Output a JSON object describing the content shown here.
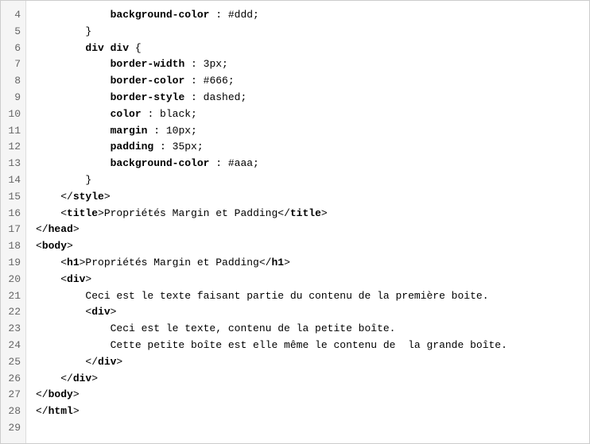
{
  "lines": [
    {
      "num": "4",
      "content": [
        {
          "t": "            "
        },
        {
          "t": "background-color",
          "bold": true
        },
        {
          "t": " : #ddd;"
        }
      ]
    },
    {
      "num": "5",
      "content": [
        {
          "t": "        }"
        }
      ]
    },
    {
      "num": "6",
      "content": [
        {
          "t": ""
        }
      ]
    },
    {
      "num": "7",
      "content": [
        {
          "t": "        "
        },
        {
          "t": "div div",
          "bold": true
        },
        {
          "t": " {"
        }
      ]
    },
    {
      "num": "8",
      "content": [
        {
          "t": "            "
        },
        {
          "t": "border-width",
          "bold": true
        },
        {
          "t": " : 3px;"
        }
      ]
    },
    {
      "num": "9",
      "content": [
        {
          "t": "            "
        },
        {
          "t": "border-color",
          "bold": true
        },
        {
          "t": " : #666;"
        }
      ]
    },
    {
      "num": "10",
      "content": [
        {
          "t": "            "
        },
        {
          "t": "border-style",
          "bold": true
        },
        {
          "t": " : dashed;"
        }
      ]
    },
    {
      "num": "11",
      "content": [
        {
          "t": "            "
        },
        {
          "t": "color",
          "bold": true
        },
        {
          "t": " : black;"
        }
      ]
    },
    {
      "num": "12",
      "content": [
        {
          "t": "            "
        },
        {
          "t": "margin",
          "bold": true
        },
        {
          "t": " : 10px;"
        }
      ]
    },
    {
      "num": "13",
      "content": [
        {
          "t": "            "
        },
        {
          "t": "padding",
          "bold": true
        },
        {
          "t": " : 35px;"
        }
      ]
    },
    {
      "num": "14",
      "content": [
        {
          "t": "            "
        },
        {
          "t": "background-color",
          "bold": true
        },
        {
          "t": " : #aaa;"
        }
      ]
    },
    {
      "num": "15",
      "content": [
        {
          "t": "        }"
        }
      ]
    },
    {
      "num": "16",
      "content": [
        {
          "t": "    </"
        },
        {
          "t": "style",
          "bold": true
        },
        {
          "t": ">"
        }
      ]
    },
    {
      "num": "17",
      "content": [
        {
          "t": "    <"
        },
        {
          "t": "title",
          "bold": true
        },
        {
          "t": ">Propriétés Margin et Padding</"
        },
        {
          "t": "title",
          "bold": true
        },
        {
          "t": ">"
        }
      ]
    },
    {
      "num": "18",
      "content": [
        {
          "t": "</"
        },
        {
          "t": "head",
          "bold": true
        },
        {
          "t": ">"
        }
      ]
    },
    {
      "num": "19",
      "content": [
        {
          "t": "<"
        },
        {
          "t": "body",
          "bold": true
        },
        {
          "t": ">"
        }
      ]
    },
    {
      "num": "20",
      "content": [
        {
          "t": "    <"
        },
        {
          "t": "h1",
          "bold": true
        },
        {
          "t": ">Propriétés Margin et Padding</"
        },
        {
          "t": "h1",
          "bold": true
        },
        {
          "t": ">"
        }
      ]
    },
    {
      "num": "21",
      "content": [
        {
          "t": "    <"
        },
        {
          "t": "div",
          "bold": true
        },
        {
          "t": ">"
        }
      ]
    },
    {
      "num": "22",
      "content": [
        {
          "t": "        Ceci est le texte faisant partie du contenu de la première boite."
        }
      ]
    },
    {
      "num": "23",
      "content": [
        {
          "t": "        <"
        },
        {
          "t": "div",
          "bold": true
        },
        {
          "t": ">"
        }
      ]
    },
    {
      "num": "24",
      "content": [
        {
          "t": "            Ceci est le texte, contenu de la petite boîte."
        }
      ]
    },
    {
      "num": "25",
      "content": [
        {
          "t": "            Cette petite boîte est elle même le contenu de  la grande boîte."
        }
      ]
    },
    {
      "num": "26",
      "content": [
        {
          "t": "        </"
        },
        {
          "t": "div",
          "bold": true
        },
        {
          "t": ">"
        }
      ]
    },
    {
      "num": "27",
      "content": [
        {
          "t": "    </"
        },
        {
          "t": "div",
          "bold": true
        },
        {
          "t": ">"
        }
      ]
    },
    {
      "num": "28",
      "content": [
        {
          "t": "</"
        },
        {
          "t": "body",
          "bold": true
        },
        {
          "t": ">"
        }
      ]
    },
    {
      "num": "29",
      "content": [
        {
          "t": "</"
        },
        {
          "t": "html",
          "bold": true
        },
        {
          "t": ">"
        }
      ]
    }
  ]
}
